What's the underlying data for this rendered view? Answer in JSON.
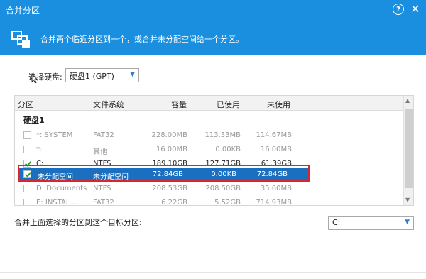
{
  "window": {
    "title": "合并分区",
    "help": "?",
    "close": "✕"
  },
  "header": {
    "description": "合并两个临近分区到一个，或合并未分配空间给一个分区。"
  },
  "disk_select": {
    "label": "选择硬盘:",
    "value": "硬盘1 (GPT)"
  },
  "table": {
    "columns": [
      "分区",
      "文件系统",
      "容量",
      "已使用",
      "未使用"
    ],
    "group": "硬盘1",
    "rows": [
      {
        "name": "*: SYSTEM",
        "fs": "FAT32",
        "cap": "228.00MB",
        "used": "113.33MB",
        "free": "114.67MB",
        "checked": false,
        "state": "disabled"
      },
      {
        "name": "*:",
        "fs": "其他",
        "cap": "16.00MB",
        "used": "0.00KB",
        "free": "16.00MB",
        "checked": false,
        "state": "disabled"
      },
      {
        "name": "C:",
        "fs": "NTFS",
        "cap": "189.10GB",
        "used": "127.71GB",
        "free": "61.39GB",
        "checked": true,
        "state": "active"
      },
      {
        "name": "未分配空间",
        "fs": "未分配空间",
        "cap": "72.84GB",
        "used": "0.00KB",
        "free": "72.84GB",
        "checked": true,
        "state": "selected"
      },
      {
        "name": "D: Documents",
        "fs": "NTFS",
        "cap": "208.53GB",
        "used": "208.50GB",
        "free": "35.60MB",
        "checked": false,
        "state": "disabled"
      },
      {
        "name": "E: INSTAL...",
        "fs": "FAT32",
        "cap": "6.22GB",
        "used": "5.52GB",
        "free": "714.93MB",
        "checked": false,
        "state": "disabled"
      }
    ]
  },
  "merge_target": {
    "label": "合并上面选择的分区到这个目标分区:",
    "value": "C:"
  },
  "colors": {
    "header": "#1a8fe0",
    "selection": "#1b6fc0",
    "highlight": "#d9262d",
    "check": "#2e9c2e"
  }
}
